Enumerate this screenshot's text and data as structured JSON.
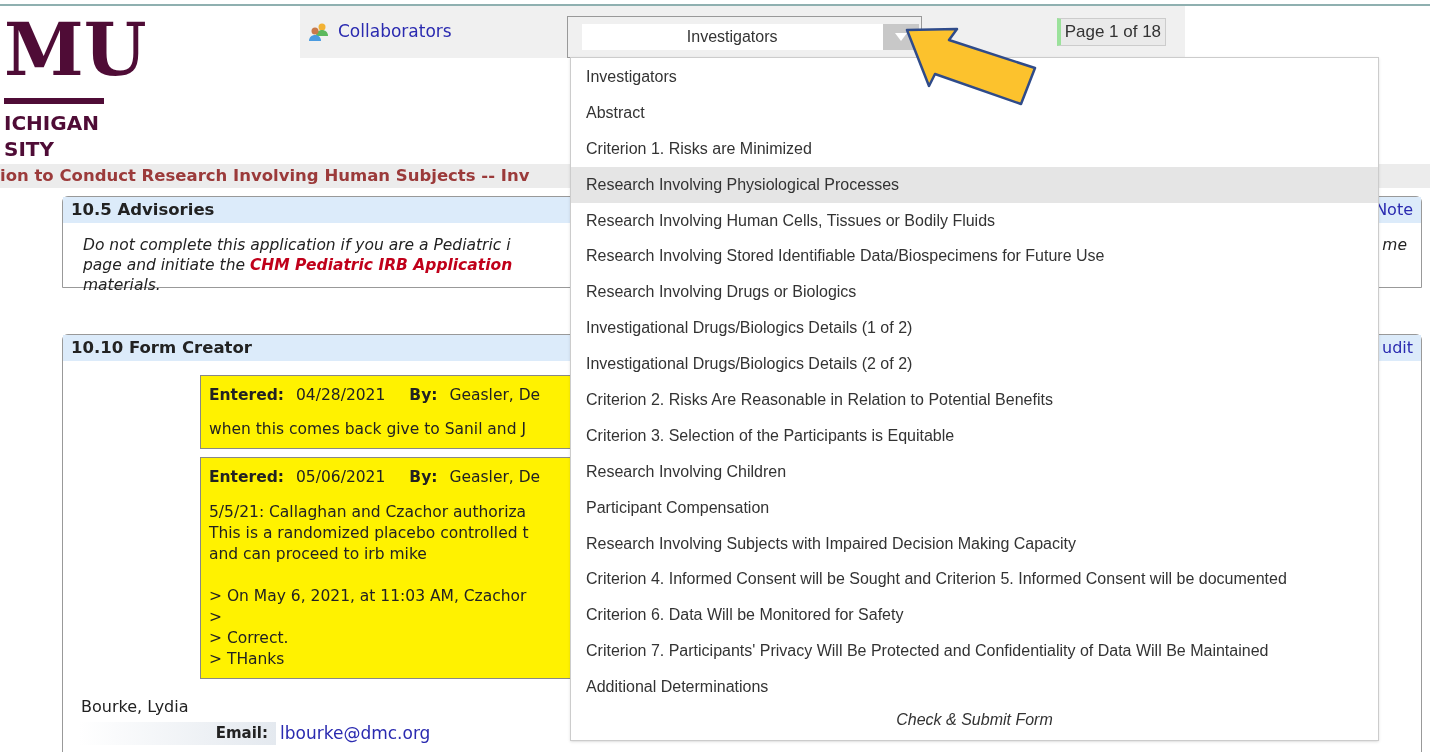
{
  "logo": {
    "lines": [
      "MU",
      "ICHIGAN",
      "SITY"
    ]
  },
  "toolbar": {
    "collaborators_link": "Collaborators",
    "page_select": {
      "value": "Investigators"
    },
    "page_indicator": "Page 1 of 18"
  },
  "form_title": "ion to Conduct Research Involving Human Subjects -- Inv",
  "sections": [
    {
      "title": "10.5  Advisories",
      "right_link": "Note",
      "body_lines": [
        "Do not complete this application if you are a Pediatric i",
        "page and initiate the **CHM Pediatric IRB Application**",
        "materials."
      ],
      "body_right": "me"
    },
    {
      "title": "10.10  Form Creator",
      "right_link": "udit",
      "notes": [
        {
          "entered_label": "Entered:",
          "entered": "04/28/2021",
          "by_label": "By:",
          "by": "Geasler, De",
          "paragraphs": [
            [
              "when this comes back give to Sanil and J"
            ]
          ]
        },
        {
          "entered_label": "Entered:",
          "entered": "05/06/2021",
          "by_label": "By:",
          "by": "Geasler, De",
          "paragraphs": [
            [
              "5/5/21: Callaghan and Czachor authoriza",
              "This is a randomized placebo controlled t",
              "and can proceed to irb mike"
            ],
            [
              "> On May 6, 2021, at 11:03 AM, Czachor",
              ">",
              "> Correct.",
              "> THanks"
            ]
          ]
        }
      ],
      "person": "Bourke, Lydia",
      "email_label": "Email:",
      "email": "lbourke@dmc.org"
    }
  ],
  "dropdown": {
    "items": [
      {
        "label": "Investigators",
        "kind": "page",
        "selected": false
      },
      {
        "label": "Abstract",
        "kind": "page",
        "selected": false
      },
      {
        "label": "Criterion 1. Risks are Minimized",
        "kind": "page",
        "selected": false
      },
      {
        "label": "Research Involving Physiological Processes",
        "kind": "page",
        "selected": true
      },
      {
        "label": "Research Involving Human Cells, Tissues or Bodily Fluids",
        "kind": "page",
        "selected": false
      },
      {
        "label": "Research Involving Stored Identifiable Data/Biospecimens for Future Use",
        "kind": "page",
        "selected": false
      },
      {
        "label": "Research Involving Drugs or Biologics",
        "kind": "page",
        "selected": false
      },
      {
        "label": "Investigational Drugs/Biologics Details (1 of 2)",
        "kind": "page",
        "selected": false
      },
      {
        "label": "Investigational Drugs/Biologics Details (2 of 2)",
        "kind": "page",
        "selected": false
      },
      {
        "label": "Criterion 2. Risks Are Reasonable in Relation to Potential Benefits",
        "kind": "page",
        "selected": false
      },
      {
        "label": "Criterion 3. Selection of the Participants is Equitable",
        "kind": "page",
        "selected": false
      },
      {
        "label": "Research Involving Children",
        "kind": "page",
        "selected": false
      },
      {
        "label": "Participant Compensation",
        "kind": "page",
        "selected": false
      },
      {
        "label": "Research Involving Subjects with Impaired Decision Making Capacity",
        "kind": "page",
        "selected": false
      },
      {
        "label": "Criterion 4. Informed Consent will be Sought and Criterion 5. Informed Consent will be documented",
        "kind": "page",
        "selected": false
      },
      {
        "label": "Criterion 6. Data Will be Monitored for Safety",
        "kind": "page",
        "selected": false
      },
      {
        "label": "Criterion 7. Participants' Privacy Will Be Protected and Confidentiality of Data Will Be Maintained",
        "kind": "page",
        "selected": false
      },
      {
        "label": "Additional Determinations",
        "kind": "page",
        "selected": false
      },
      {
        "label": "Check & Submit Form",
        "kind": "action",
        "selected": false
      }
    ]
  }
}
